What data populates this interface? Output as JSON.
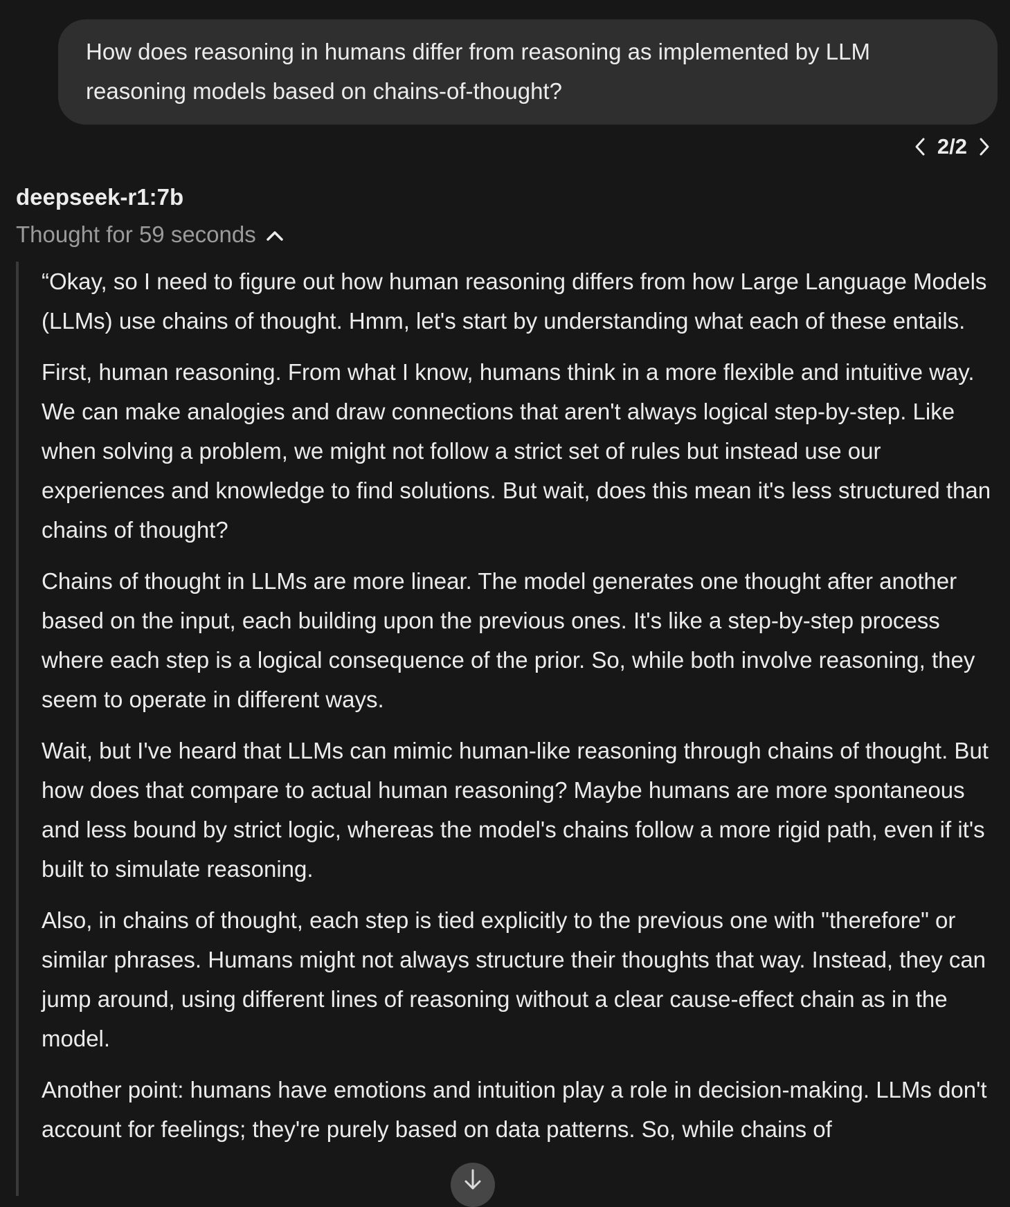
{
  "user_message": {
    "text": "How does reasoning in humans differ from reasoning as implemented by LLM reasoning models based on chains-of-thought?"
  },
  "pager": {
    "label": "2/2",
    "prev_icon": "chevron-left-icon",
    "next_icon": "chevron-right-icon"
  },
  "response": {
    "model_name": "deepseek-r1:7b",
    "thought_toggle_label": "Thought for 59 seconds",
    "thought_toggle_icon": "chevron-up-icon",
    "thought_paragraphs": [
      "“Okay, so I need to figure out how human reasoning differs from how Large Language Models (LLMs) use chains of thought. Hmm, let's start by understanding what each of these entails.",
      "First, human reasoning. From what I know, humans think in a more flexible and intuitive way. We can make analogies and draw connections that aren't always logical step-by-step. Like when solving a problem, we might not follow a strict set of rules but instead use our experiences and knowledge to find solutions. But wait, does this mean it's less structured than chains of thought?",
      "Chains of thought in LLMs are more linear. The model generates one thought after another based on the input, each building upon the previous ones. It's like a step-by-step process where each step is a logical consequence of the prior. So, while both involve reasoning, they seem to operate in different ways.",
      "Wait, but I've heard that LLMs can mimic human-like reasoning through chains of thought. But how does that compare to actual human reasoning? Maybe humans are more spontaneous and less bound by strict logic, whereas the model's chains follow a more rigid path, even if it's built to simulate reasoning.",
      "Also, in chains of thought, each step is tied explicitly to the previous one with \"therefore\" or similar phrases. Humans might not always structure their thoughts that way. Instead, they can jump around, using different lines of reasoning without a clear cause-effect chain as in the model.",
      "Another point: humans have emotions and intuition play a role in decision-making. LLMs don't account for feelings; they're purely based on data patterns. So, while chains of"
    ]
  },
  "scroll_button_icon": "arrow-down-icon",
  "colors": {
    "background": "#171717",
    "bubble": "#2f2f2f",
    "text": "#ececec",
    "muted_text": "#9b9b9b",
    "quote_border": "#3a3a3a"
  }
}
